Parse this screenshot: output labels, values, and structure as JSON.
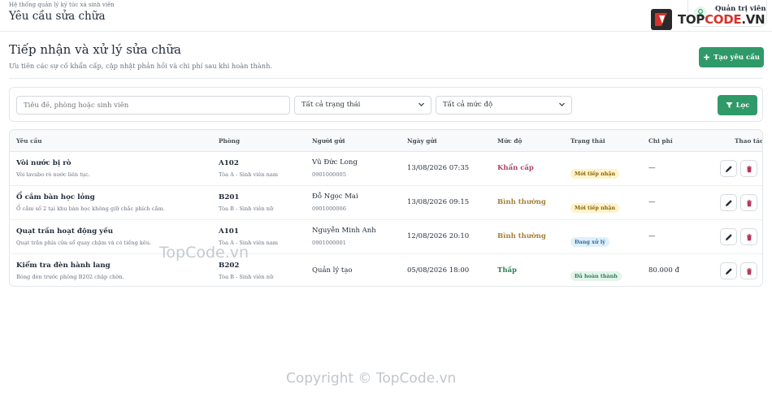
{
  "header": {
    "breadcrumb": "Hệ thống quản lý ký túc xá sinh viên",
    "title": "Yêu cầu sửa chữa",
    "user_name": "Quản trị viên",
    "user_icon": "user-icon"
  },
  "logo": {
    "part1": "TOP",
    "part2": "CODE",
    "part3": ".VN",
    "accent": "#d8322a"
  },
  "page": {
    "title": "Tiếp nhận và xử lý sửa chữa",
    "subtitle": "Ưu tiên các sự cố khẩn cấp, cập nhật phản hồi và chi phí sau khi hoàn thành.",
    "create_label": "Tạo yêu cầu",
    "brand_color": "#2f9a68"
  },
  "filters": {
    "search_placeholder": "Tiêu đề, phòng hoặc sinh viên",
    "status_select": "Tất cả trạng thái",
    "level_select": "Tất cả mức độ",
    "filter_label": "Lọc"
  },
  "table": {
    "headers": {
      "request": "Yêu cầu",
      "room": "Phòng",
      "sender": "Người gửi",
      "date": "Ngày gửi",
      "level": "Mức độ",
      "status": "Trạng thái",
      "cost": "Chi phí",
      "actions": "Thao tác"
    },
    "rows": [
      {
        "title": "Vòi nước bị rò",
        "desc": "Vòi lavabo rò nước liên tục.",
        "room": "A102",
        "building": "Tòa A - Sinh viên nam",
        "sender": "Vũ Đức Long",
        "phone": "0901000005",
        "date": "13/08/2026 07:35",
        "level": "Khẩn cấp",
        "status": "Mới tiếp nhận",
        "cost": "—"
      },
      {
        "title": "Ổ cắm bàn học lỏng",
        "desc": "Ổ cắm số 2 tại khu bàn học không giữ chắc phích cắm.",
        "room": "B201",
        "building": "Tòa B - Sinh viên nữ",
        "sender": "Đỗ Ngọc Mai",
        "phone": "0901000006",
        "date": "13/08/2026 09:15",
        "level": "Bình thường",
        "status": "Mới tiếp nhận",
        "cost": "—"
      },
      {
        "title": "Quạt trần hoạt động yếu",
        "desc": "Quạt trần phía cửa sổ quay chậm và có tiếng kêu.",
        "room": "A101",
        "building": "Tòa A - Sinh viên nam",
        "sender": "Nguyễn Minh Anh",
        "phone": "0901000001",
        "date": "12/08/2026 20:10",
        "level": "Bình thường",
        "status": "Đang xử lý",
        "cost": "—"
      },
      {
        "title": "Kiểm tra đèn hành lang",
        "desc": "Bóng đèn trước phòng B202 chập chờn.",
        "room": "B202",
        "building": "Tòa B - Sinh viên nữ",
        "sender": "Quản lý tạo",
        "phone": "",
        "date": "05/08/2026 18:00",
        "level": "Thấp",
        "status": "Đã hoàn thành",
        "cost": "80.000 đ"
      }
    ]
  },
  "colors": {
    "level_urgent": "#b0456a",
    "level_normal": "#a8803a",
    "level_low": "#2f7f55",
    "badge_new_bg": "#fff3cd",
    "badge_new_fg": "#8a6400",
    "badge_progress_bg": "#e0f0fb",
    "badge_progress_fg": "#2a6f9e",
    "badge_done_bg": "#e3f4ea",
    "badge_done_fg": "#2f7f55",
    "delete_icon": "#b8375a"
  },
  "watermarks": {
    "center": "TopCode.vn",
    "bottom": "Copyright © TopCode.vn"
  }
}
